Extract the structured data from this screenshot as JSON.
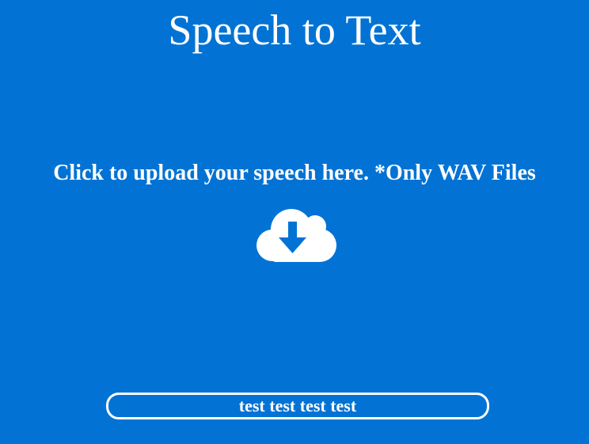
{
  "header": {
    "title": "Speech to Text"
  },
  "upload": {
    "label": "Click to upload your speech here. *Only WAV Files",
    "icon": "cloud-download-icon"
  },
  "result": {
    "text": "test test test test"
  },
  "colors": {
    "background": "#0273d4",
    "foreground": "#ffffff"
  }
}
